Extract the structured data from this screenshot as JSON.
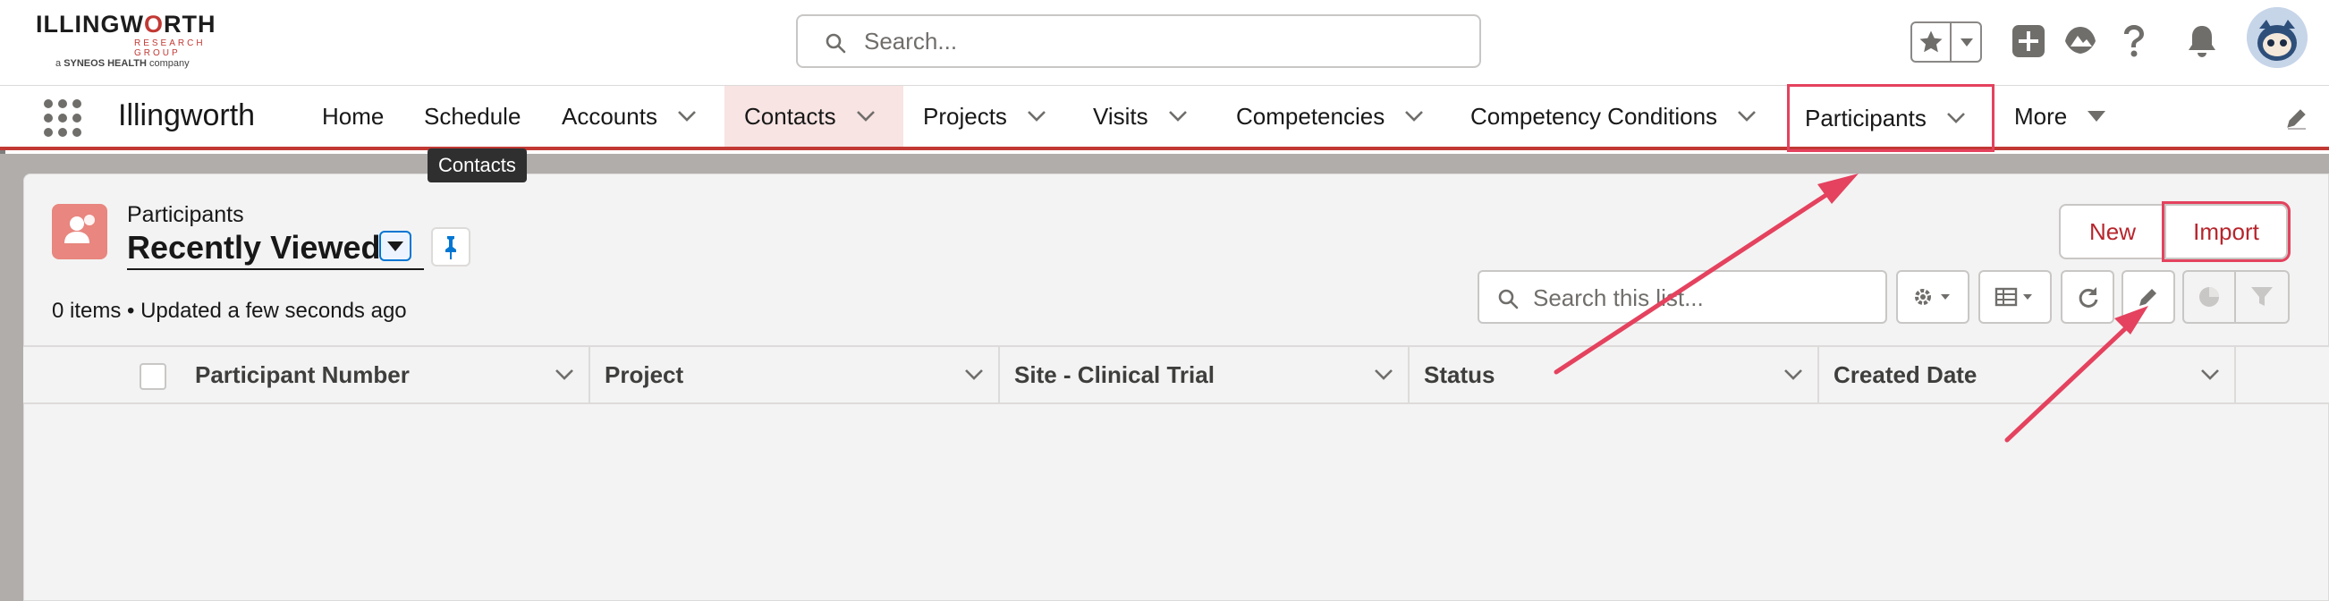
{
  "header": {
    "logo": {
      "name_pre": "ILLINGW",
      "name_o": "O",
      "name_post": "RTH",
      "sub": "RESEARCH GROUP",
      "company_prefix": "a",
      "company_name": "SYNEOS HEALTH",
      "company_suffix": "company"
    },
    "search_placeholder": "Search..."
  },
  "nav": {
    "app_name": "Illingworth",
    "items": [
      {
        "label": "Home"
      },
      {
        "label": "Schedule"
      },
      {
        "label": "Accounts"
      },
      {
        "label": "Contacts"
      },
      {
        "label": "Projects"
      },
      {
        "label": "Visits"
      },
      {
        "label": "Competencies"
      },
      {
        "label": "Competency Conditions"
      },
      {
        "label": "Participants"
      },
      {
        "label": "More"
      }
    ],
    "tooltip": "Contacts",
    "active": "Contacts",
    "highlighted": "Participants"
  },
  "list_view": {
    "object_label": "Participants",
    "title": "Recently Viewed",
    "meta": "0 items • Updated a few seconds ago",
    "buttons": {
      "new": "New",
      "import": "Import"
    },
    "search_placeholder": "Search this list...",
    "columns": [
      "Participant Number",
      "Project",
      "Site - Clinical Trial",
      "Status",
      "Created Date"
    ]
  },
  "colors": {
    "brand_red": "#c23934",
    "annotation_pink": "#e4425e",
    "object_icon": "#e8867f"
  },
  "icons": [
    "search-icon",
    "star-icon",
    "add-icon",
    "trailhead-icon",
    "help-icon",
    "bell-icon",
    "app-launcher-icon",
    "chevron-down-icon",
    "pin-icon",
    "gear-icon",
    "table-icon",
    "refresh-icon",
    "pencil-icon",
    "chart-icon",
    "filter-icon"
  ]
}
